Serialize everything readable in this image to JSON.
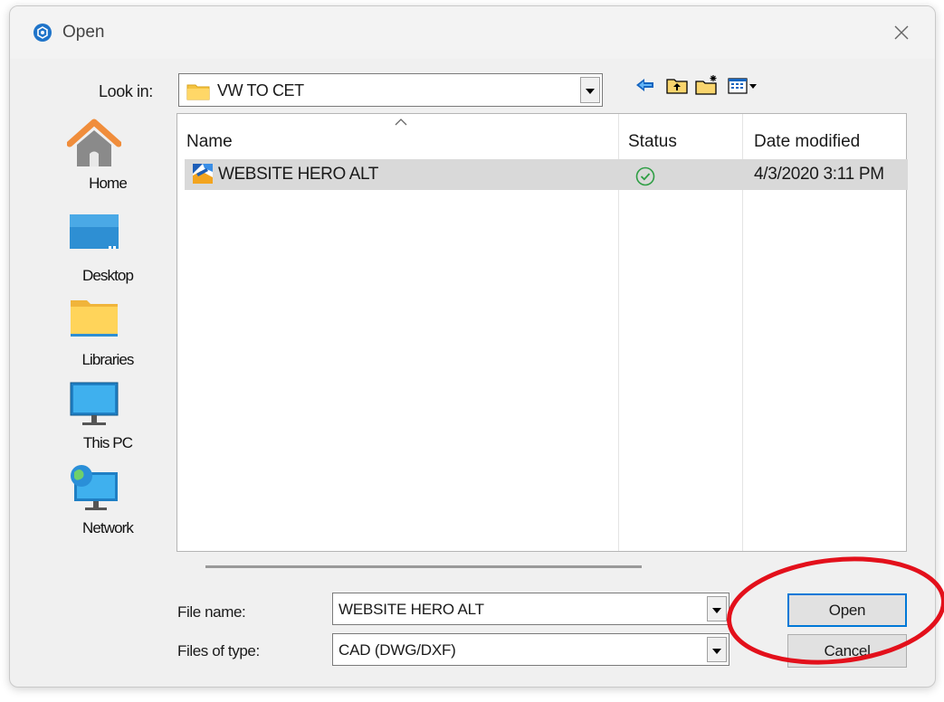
{
  "dialog": {
    "title": "Open",
    "icons": {
      "app": "app-logo-icon",
      "close": "close-icon"
    }
  },
  "lookin": {
    "label": "Look in:",
    "value": "VW TO CET",
    "icons": {
      "folder": "folder-icon",
      "dropdown": "chevron-down-icon"
    }
  },
  "toolbar": {
    "icons": [
      "back-arrow-icon",
      "up-one-level-icon",
      "new-folder-icon",
      "view-menu-icon"
    ]
  },
  "places": [
    {
      "label": "Home",
      "icon": "home-icon"
    },
    {
      "label": "Desktop",
      "icon": "desktop-icon"
    },
    {
      "label": "Libraries",
      "icon": "libraries-icon"
    },
    {
      "label": "This PC",
      "icon": "this-pc-icon"
    },
    {
      "label": "Network",
      "icon": "network-icon"
    }
  ],
  "file_list": {
    "columns": [
      "Name",
      "Status",
      "Date modified"
    ],
    "rows": [
      {
        "name": "WEBSITE HERO ALT",
        "status_icon": "sync-ok-check-icon",
        "date": "4/3/2020 3:11 PM",
        "selected": true
      }
    ]
  },
  "file_name": {
    "label": "File name:",
    "value": "WEBSITE HERO ALT"
  },
  "file_type": {
    "label": "Files of type:",
    "value": "CAD (DWG/DXF)"
  },
  "buttons": {
    "open": "Open",
    "cancel": "Cancel"
  },
  "colors": {
    "accent": "#0078d7",
    "selection": "#d9d9d9",
    "annotation": "#e3101b",
    "status_ok": "#2e9e44",
    "folder": "#f5c441"
  },
  "annotation": {
    "shape": "ellipse",
    "target": "open-button"
  }
}
